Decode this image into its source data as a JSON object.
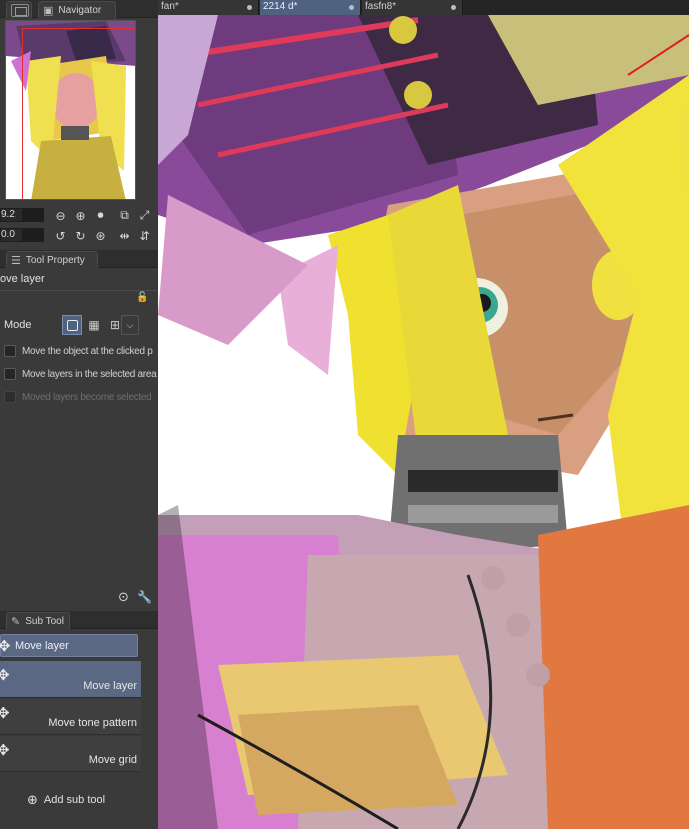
{
  "navigator": {
    "tab_label": "Navigator",
    "zoom_value": "9.2",
    "rotate_value": "0.0"
  },
  "tool_property": {
    "tab_label": "Tool Property",
    "tool_name": "ove layer",
    "mode_label": "Mode",
    "options": [
      {
        "label": "Move the object at the clicked p",
        "enabled": true
      },
      {
        "label": "Move layers in the selected area",
        "enabled": true
      },
      {
        "label": "Moved layers become selected",
        "enabled": false
      }
    ]
  },
  "sub_tool": {
    "tab_label": "Sub Tool",
    "group_label": "Move layer",
    "items": [
      {
        "label": "Move layer",
        "selected": true
      },
      {
        "label": "Move tone pattern",
        "selected": false
      },
      {
        "label": "Move grid",
        "selected": false
      }
    ],
    "add_label": "Add sub tool"
  },
  "doc_tabs": [
    {
      "label": "fan*",
      "active": false
    },
    {
      "label": "2214 d*",
      "active": true
    },
    {
      "label": "fasfn8*",
      "active": false
    }
  ],
  "colors": {
    "accent_tab": "#4f6380",
    "selected_item": "#5b6883",
    "panel_bg": "#3a3a3a"
  }
}
